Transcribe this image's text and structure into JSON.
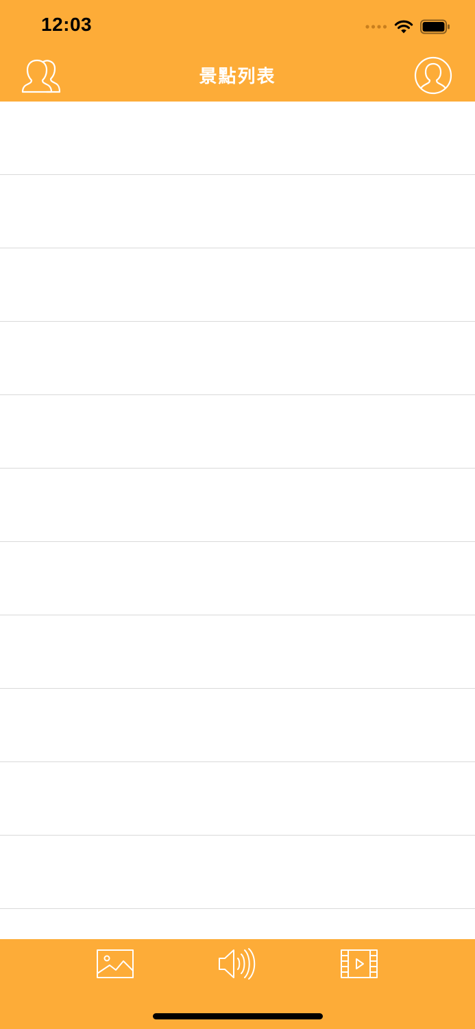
{
  "status_bar": {
    "time": "12:03",
    "signal_icon": "signal-dots-icon",
    "wifi_icon": "wifi-icon",
    "battery_icon": "battery-icon"
  },
  "nav_bar": {
    "title": "景點列表",
    "left_icon": "users-icon",
    "right_icon": "profile-icon"
  },
  "list": {
    "row_count": 11,
    "rows": [
      "",
      "",
      "",
      "",
      "",
      "",
      "",
      "",
      "",
      "",
      ""
    ]
  },
  "toolbar": {
    "items": [
      {
        "icon": "image-icon"
      },
      {
        "icon": "audio-icon"
      },
      {
        "icon": "video-icon"
      }
    ]
  },
  "colors": {
    "accent": "#FDAC38",
    "separator": "#D9D9D9",
    "background": "#FFFFFF",
    "icon_stroke": "#FFFFFF"
  }
}
